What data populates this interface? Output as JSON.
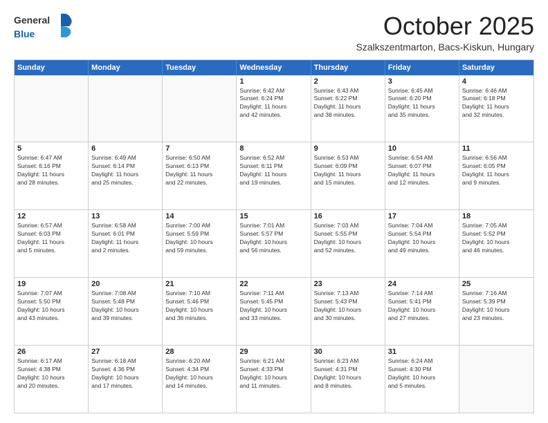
{
  "logo": {
    "general": "General",
    "blue": "Blue"
  },
  "header": {
    "month": "October 2025",
    "location": "Szalkszentmarton, Bacs-Kiskun, Hungary"
  },
  "weekdays": [
    "Sunday",
    "Monday",
    "Tuesday",
    "Wednesday",
    "Thursday",
    "Friday",
    "Saturday"
  ],
  "weeks": [
    [
      {
        "day": "",
        "info": "",
        "empty": true
      },
      {
        "day": "",
        "info": "",
        "empty": true
      },
      {
        "day": "",
        "info": "",
        "empty": true
      },
      {
        "day": "1",
        "info": "Sunrise: 6:42 AM\nSunset: 6:24 PM\nDaylight: 11 hours\nand 42 minutes.",
        "empty": false
      },
      {
        "day": "2",
        "info": "Sunrise: 6:43 AM\nSunset: 6:22 PM\nDaylight: 11 hours\nand 38 minutes.",
        "empty": false
      },
      {
        "day": "3",
        "info": "Sunrise: 6:45 AM\nSunset: 6:20 PM\nDaylight: 11 hours\nand 35 minutes.",
        "empty": false
      },
      {
        "day": "4",
        "info": "Sunrise: 6:46 AM\nSunset: 6:18 PM\nDaylight: 11 hours\nand 32 minutes.",
        "empty": false
      }
    ],
    [
      {
        "day": "5",
        "info": "Sunrise: 6:47 AM\nSunset: 6:16 PM\nDaylight: 11 hours\nand 28 minutes.",
        "empty": false
      },
      {
        "day": "6",
        "info": "Sunrise: 6:49 AM\nSunset: 6:14 PM\nDaylight: 11 hours\nand 25 minutes.",
        "empty": false
      },
      {
        "day": "7",
        "info": "Sunrise: 6:50 AM\nSunset: 6:13 PM\nDaylight: 11 hours\nand 22 minutes.",
        "empty": false
      },
      {
        "day": "8",
        "info": "Sunrise: 6:52 AM\nSunset: 6:11 PM\nDaylight: 11 hours\nand 19 minutes.",
        "empty": false
      },
      {
        "day": "9",
        "info": "Sunrise: 6:53 AM\nSunset: 6:09 PM\nDaylight: 11 hours\nand 15 minutes.",
        "empty": false
      },
      {
        "day": "10",
        "info": "Sunrise: 6:54 AM\nSunset: 6:07 PM\nDaylight: 11 hours\nand 12 minutes.",
        "empty": false
      },
      {
        "day": "11",
        "info": "Sunrise: 6:56 AM\nSunset: 6:05 PM\nDaylight: 11 hours\nand 9 minutes.",
        "empty": false
      }
    ],
    [
      {
        "day": "12",
        "info": "Sunrise: 6:57 AM\nSunset: 6:03 PM\nDaylight: 11 hours\nand 5 minutes.",
        "empty": false
      },
      {
        "day": "13",
        "info": "Sunrise: 6:58 AM\nSunset: 6:01 PM\nDaylight: 11 hours\nand 2 minutes.",
        "empty": false
      },
      {
        "day": "14",
        "info": "Sunrise: 7:00 AM\nSunset: 5:59 PM\nDaylight: 10 hours\nand 59 minutes.",
        "empty": false
      },
      {
        "day": "15",
        "info": "Sunrise: 7:01 AM\nSunset: 5:57 PM\nDaylight: 10 hours\nand 56 minutes.",
        "empty": false
      },
      {
        "day": "16",
        "info": "Sunrise: 7:03 AM\nSunset: 5:55 PM\nDaylight: 10 hours\nand 52 minutes.",
        "empty": false
      },
      {
        "day": "17",
        "info": "Sunrise: 7:04 AM\nSunset: 5:54 PM\nDaylight: 10 hours\nand 49 minutes.",
        "empty": false
      },
      {
        "day": "18",
        "info": "Sunrise: 7:05 AM\nSunset: 5:52 PM\nDaylight: 10 hours\nand 46 minutes.",
        "empty": false
      }
    ],
    [
      {
        "day": "19",
        "info": "Sunrise: 7:07 AM\nSunset: 5:50 PM\nDaylight: 10 hours\nand 43 minutes.",
        "empty": false
      },
      {
        "day": "20",
        "info": "Sunrise: 7:08 AM\nSunset: 5:48 PM\nDaylight: 10 hours\nand 39 minutes.",
        "empty": false
      },
      {
        "day": "21",
        "info": "Sunrise: 7:10 AM\nSunset: 5:46 PM\nDaylight: 10 hours\nand 36 minutes.",
        "empty": false
      },
      {
        "day": "22",
        "info": "Sunrise: 7:11 AM\nSunset: 5:45 PM\nDaylight: 10 hours\nand 33 minutes.",
        "empty": false
      },
      {
        "day": "23",
        "info": "Sunrise: 7:13 AM\nSunset: 5:43 PM\nDaylight: 10 hours\nand 30 minutes.",
        "empty": false
      },
      {
        "day": "24",
        "info": "Sunrise: 7:14 AM\nSunset: 5:41 PM\nDaylight: 10 hours\nand 27 minutes.",
        "empty": false
      },
      {
        "day": "25",
        "info": "Sunrise: 7:16 AM\nSunset: 5:39 PM\nDaylight: 10 hours\nand 23 minutes.",
        "empty": false
      }
    ],
    [
      {
        "day": "26",
        "info": "Sunrise: 6:17 AM\nSunset: 4:38 PM\nDaylight: 10 hours\nand 20 minutes.",
        "empty": false
      },
      {
        "day": "27",
        "info": "Sunrise: 6:18 AM\nSunset: 4:36 PM\nDaylight: 10 hours\nand 17 minutes.",
        "empty": false
      },
      {
        "day": "28",
        "info": "Sunrise: 6:20 AM\nSunset: 4:34 PM\nDaylight: 10 hours\nand 14 minutes.",
        "empty": false
      },
      {
        "day": "29",
        "info": "Sunrise: 6:21 AM\nSunset: 4:33 PM\nDaylight: 10 hours\nand 11 minutes.",
        "empty": false
      },
      {
        "day": "30",
        "info": "Sunrise: 6:23 AM\nSunset: 4:31 PM\nDaylight: 10 hours\nand 8 minutes.",
        "empty": false
      },
      {
        "day": "31",
        "info": "Sunrise: 6:24 AM\nSunset: 4:30 PM\nDaylight: 10 hours\nand 5 minutes.",
        "empty": false
      },
      {
        "day": "",
        "info": "",
        "empty": true
      }
    ]
  ]
}
